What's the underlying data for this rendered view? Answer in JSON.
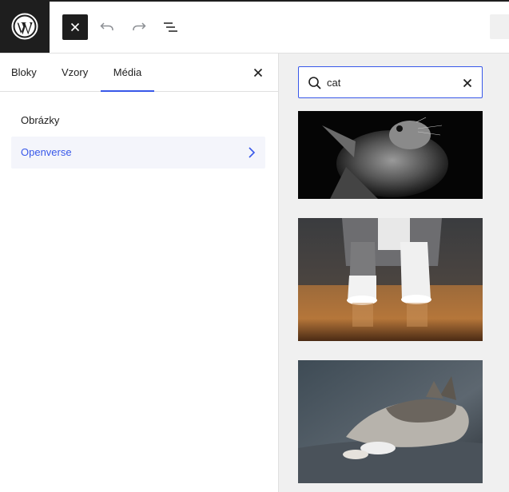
{
  "toolbar": {
    "logo_icon": "wordpress-logo-icon",
    "close_icon": "close-icon",
    "undo_icon": "undo-icon",
    "redo_icon": "redo-icon",
    "list_view_icon": "list-view-icon"
  },
  "inserter": {
    "tabs": [
      {
        "label": "Bloky"
      },
      {
        "label": "Vzory"
      },
      {
        "label": "Média",
        "active": true
      }
    ],
    "categories": [
      {
        "label": "Obrázky"
      },
      {
        "label": "Openverse",
        "selected": true
      }
    ]
  },
  "media": {
    "search": {
      "value": "cat",
      "icon": "search-icon",
      "clear_icon": "close-icon"
    },
    "results": [
      {
        "subject": "kitten looking up on black background"
      },
      {
        "subject": "cat paws on wooden floor"
      },
      {
        "subject": "sleeping cat on couch"
      }
    ]
  },
  "colors": {
    "accent": "#3858e9",
    "dark": "#1e1e1e",
    "panel_bg": "#f0f0f0"
  }
}
